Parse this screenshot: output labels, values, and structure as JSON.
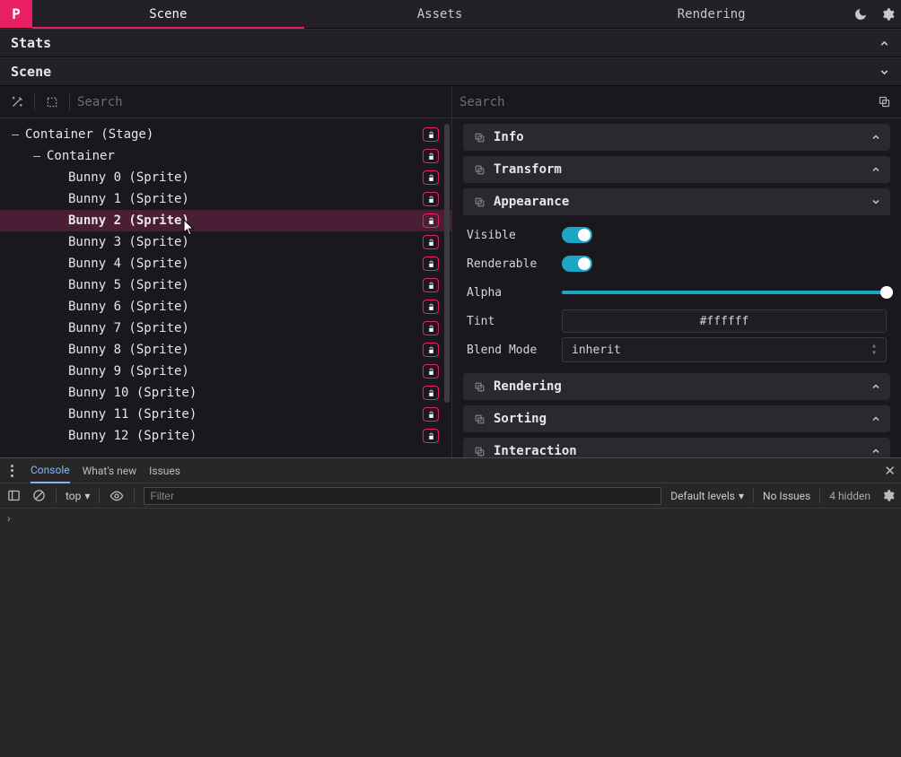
{
  "logo_letter": "P",
  "toptabs": {
    "scene": "Scene",
    "assets": "Assets",
    "rendering": "Rendering"
  },
  "panels": {
    "stats": "Stats",
    "scene": "Scene"
  },
  "search_placeholder": "Search",
  "tree": {
    "root": "Container (Stage)",
    "child": "Container",
    "items": [
      "Bunny 0 (Sprite)",
      "Bunny 1 (Sprite)",
      "Bunny 2 (Sprite)",
      "Bunny 3 (Sprite)",
      "Bunny 4 (Sprite)",
      "Bunny 5 (Sprite)",
      "Bunny 6 (Sprite)",
      "Bunny 7 (Sprite)",
      "Bunny 8 (Sprite)",
      "Bunny 9 (Sprite)",
      "Bunny 10 (Sprite)",
      "Bunny 11 (Sprite)",
      "Bunny 12 (Sprite)"
    ],
    "selected_index": 2
  },
  "sections": {
    "info": "Info",
    "transform": "Transform",
    "appearance": "Appearance",
    "rendering": "Rendering",
    "sorting": "Sorting",
    "interaction": "Interaction"
  },
  "appearance": {
    "visible_label": "Visible",
    "renderable_label": "Renderable",
    "alpha_label": "Alpha",
    "tint_label": "Tint",
    "tint_value": "#ffffff",
    "blend_label": "Blend Mode",
    "blend_value": "inherit"
  },
  "devtools": {
    "tabs": {
      "console": "Console",
      "whatsnew": "What's new",
      "issues": "Issues"
    },
    "context": "top",
    "filter_placeholder": "Filter",
    "levels": "Default levels",
    "no_issues": "No Issues",
    "hidden": "4 hidden"
  }
}
